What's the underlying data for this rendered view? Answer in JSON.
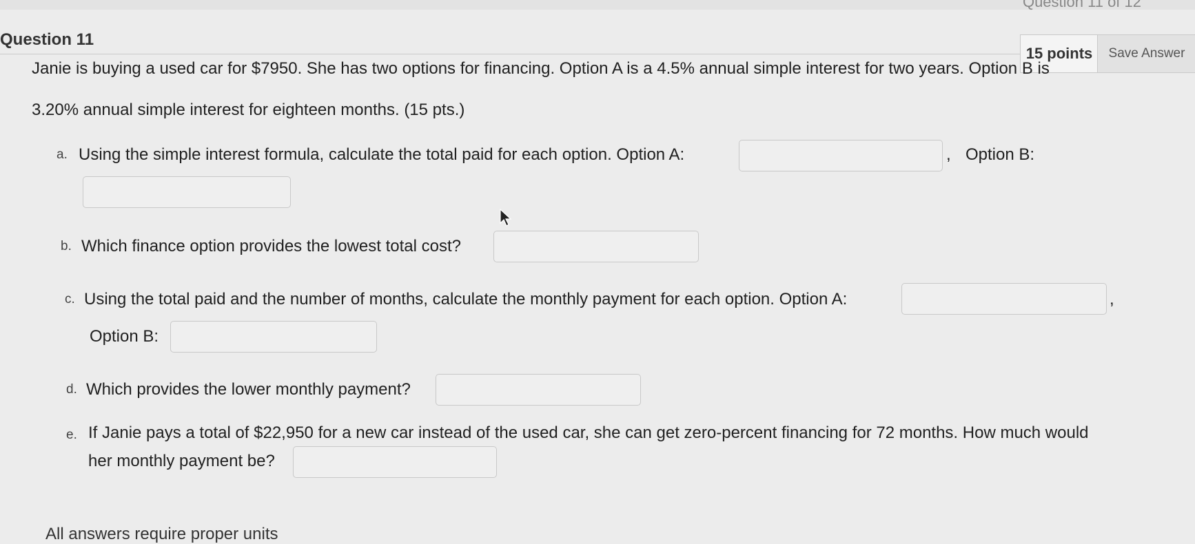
{
  "header": {
    "question_counter": "Question 11 of 12",
    "question_title": "Question 11",
    "points": "15 points",
    "save_label": "Save Answer"
  },
  "question": {
    "intro_line1": "Janie is buying a used car for $7950. She has two options for financing. Option A is a 4.5% annual simple interest for two years. Option B is",
    "intro_line2": "3.20% annual simple interest for eighteen months.  (15 pts.)",
    "parts": {
      "a": {
        "label": "a.",
        "text": "Using the simple interest formula, calculate the total paid for each option.  Option A:",
        "sep": ",",
        "text2": "Option B:",
        "answer_a": "",
        "answer_b": ""
      },
      "b": {
        "label": "b.",
        "text": "Which finance option provides the lowest total cost?",
        "answer": ""
      },
      "c": {
        "label": "c.",
        "text": "Using the total paid and the number of months, calculate the monthly payment for each option.  Option A:",
        "sep": ",",
        "text2": "Option B:",
        "answer_a": "",
        "answer_b": ""
      },
      "d": {
        "label": "d.",
        "text": "Which provides the lower monthly payment?",
        "answer": ""
      },
      "e": {
        "label": "e.",
        "text_line1": "If Janie pays a total of $22,950 for a new car instead of the used car, she can get zero-percent financing for 72 months. How much would",
        "text_line2": "her monthly payment be?",
        "answer": ""
      }
    },
    "footer_note": "All answers require proper units"
  },
  "colors": {
    "background": "#ececec",
    "input_border": "#c8c8c8",
    "button_bg": "#e2e2e2"
  }
}
